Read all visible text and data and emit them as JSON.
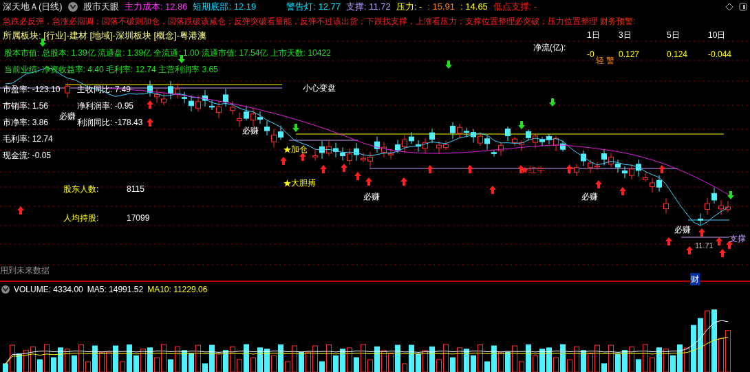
{
  "header": {
    "title": "深天地Ａ(日线)",
    "indicator_name": "股市天眼",
    "indicators": [
      {
        "text": "主力成本: 12.86",
        "color": "#ff33ff"
      },
      {
        "text": "短期底部: 12.19",
        "color": "#00d8ff"
      },
      {
        "text": "警告灯: 12.77",
        "color": "#00e5ff"
      },
      {
        "text": "支撑: 11.72",
        "color": "#b8a0ff"
      },
      {
        "text": "压力: -",
        "color": "#ffff00"
      },
      {
        "text": ": 15.91",
        "color": "#ff8000"
      },
      {
        "text": ": 14.65",
        "color": "#ffff00"
      },
      {
        "text": "低点支撑: -",
        "color": "#ff2020"
      }
    ]
  },
  "warning_text": "急跌必反弹，急涨必回调；回落不破则加仓，回落跌破该减仓；反弹突破看量能，反弹不过该出货；下跌找支撑，上涨看压力；支撑位置整理必突破；压力位置整理",
  "finance_warning": "财务预警:",
  "sectors": "所属板块: [行业]-建材 [地域]-深圳板块 [概念]-粤港澳",
  "share_info": "股本市值: 总股本: 1.39亿 流通盘: 1.39亿 全流通: 1.00 流通市值: 17.54亿 上市天数: 10422",
  "performance": "当前业绩: 净资收益率: 4.40 毛利率: 12.74 主营利润率 3.65",
  "net_flow": {
    "label": "净流(亿):",
    "columns": [
      "1日",
      "3日",
      "5日",
      "10日"
    ],
    "values": [
      "-0",
      "0.127",
      "0.124",
      "-0.044"
    ],
    "alert": "轻 警"
  },
  "ratios": [
    "市盈率: -123.10",
    "市销率: 1.56",
    "市净率: 3.86",
    "毛利率: 12.74",
    "现金流: -0.05"
  ],
  "growth": [
    "主收同比: 7.49",
    "净利润率: -0.95",
    "利润同比: -178.43"
  ],
  "holders": [
    {
      "label": "股东人数:",
      "value": "8115"
    },
    {
      "label": "人均持股:",
      "value": "17099"
    }
  ],
  "chart_labels": [
    {
      "kind": "note",
      "text": "小心变盘"
    },
    {
      "kind": "note",
      "text": "必赚"
    },
    {
      "kind": "note",
      "text": "必赚"
    },
    {
      "kind": "note",
      "text": "必赚"
    },
    {
      "kind": "note",
      "text": "必赚"
    },
    {
      "kind": "note",
      "text": "必赚"
    },
    {
      "kind": "star",
      "text": "加仓",
      "color": "#ffff00"
    },
    {
      "kind": "star",
      "text": "大胆搏",
      "color": "#ffff00"
    },
    {
      "kind": "star",
      "text": "红牛",
      "color": "#ff2020"
    },
    {
      "kind": "price",
      "text": "11.71"
    },
    {
      "kind": "support",
      "text": "支撑"
    }
  ],
  "future_data_note": "用到未来数据",
  "finance_badge": "财",
  "volume": {
    "volume": "VOLUME: 4334.00",
    "ma5": "MA5: 14991.52",
    "ma10": "MA10: 11229.06"
  }
}
